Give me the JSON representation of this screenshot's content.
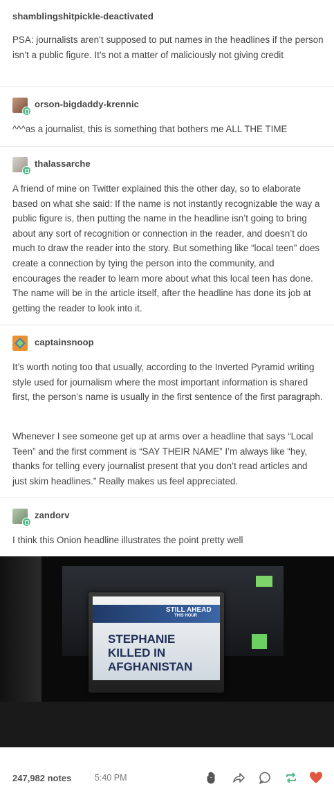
{
  "posts": [
    {
      "username": "shamblingshitpickle-deactivated",
      "text": "PSA: journalists aren’t supposed to put names in the headlines if the person isn’t a public figure. It’s not a matter of maliciously not giving credit"
    },
    {
      "username": "orson-bigdaddy-krennic",
      "text": "^^^as a journalist, this is something that bothers me ALL THE TIME"
    },
    {
      "username": "thalassarche",
      "text": "A friend of mine on Twitter explained this the other day, so to elaborate based on what she said: If the name is not instantly recognizable the way a public figure is, then putting the name in the headline isn’t going to bring about any sort of recognition or connection in the reader, and doesn’t do much to draw the reader into the story. But something like “local teen” does create a connection by tying the person into the community, and encourages the reader to learn more about what this local teen has done. The name will be in the article itself, after the headline has done its job at getting the reader to look into it."
    },
    {
      "username": "captainsnoop",
      "text1": "It’s worth noting too that usually, according to the Inverted Pyramid writing style used for journalism where the most important information is shared first, the person’s name is usually in the first sentence of the first paragraph.",
      "text2": "Whenever I see someone get up at arms over a headline that says “Local Teen” and the first comment is “SAY THEIR NAME” I’m always like “hey, thanks for telling every journalist present that you don’t read articles and just skim headlines.” Really makes us feel appreciated."
    },
    {
      "username": "zandorv",
      "text": "I think this Onion headline illustrates the point pretty well"
    }
  ],
  "image": {
    "still_ahead": "STILL AHEAD",
    "this_hour": "THIS HOUR",
    "headline": "STEPHANIE KILLED IN AFGHANISTAN"
  },
  "footer": {
    "notes": "247,982 notes",
    "time": "5:40 PM",
    "icons": [
      "like-hand-icon",
      "share-icon",
      "reply-icon",
      "reblog-icon",
      "heart-icon"
    ]
  },
  "colors": {
    "reblog_green": "#56bc8a",
    "heart_red": "#e0573e"
  }
}
